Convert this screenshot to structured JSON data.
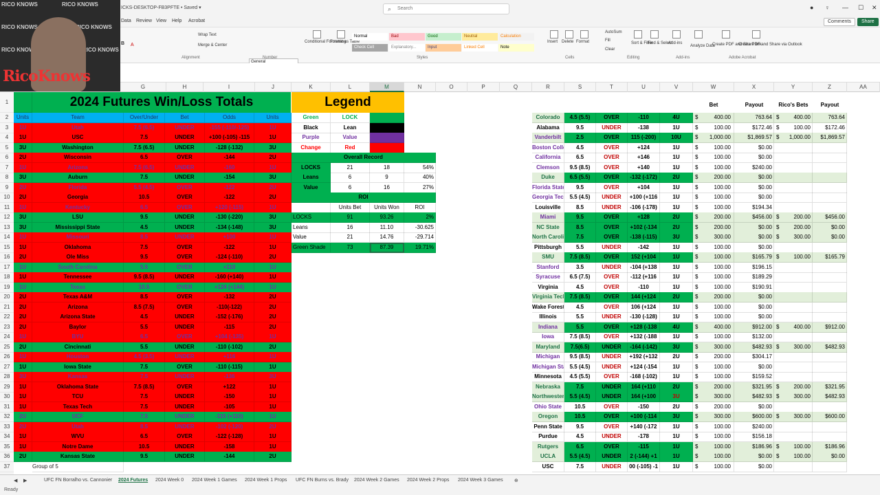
{
  "titlebar": {
    "file_name": "ICKS-DESKTOP-FB3PFTE • Saved ▾",
    "search_placeholder": "Search"
  },
  "tabs": [
    "Data",
    "Review",
    "View",
    "Help",
    "Acrobat"
  ],
  "top_buttons": {
    "comments": "Comments",
    "share": "Share"
  },
  "ribbon": {
    "labels": [
      "Wrap Text",
      "Merge & Center",
      "General",
      "Conditional Formatting",
      "Format as Table",
      "Insert",
      "Delete",
      "Format",
      "AutoSum",
      "Fill",
      "Clear",
      "Sort & Filter",
      "Find & Select",
      "Add-ins",
      "Analyze Data",
      "Create PDF and Share link",
      "Create PDF and Share via Outlook"
    ],
    "groups": [
      "Alignment",
      "Number",
      "Styles",
      "Cells",
      "Editing",
      "Add-ins",
      "Adobe Acrobat"
    ],
    "styles": [
      "Normal",
      "Bad",
      "Good",
      "Neutral",
      "Calculation",
      "Check Cell",
      "Explanatory...",
      "Input",
      "Linked Cell",
      "Note"
    ]
  },
  "columns": [
    "G",
    "H",
    "I",
    "J",
    "K",
    "L",
    "M",
    "N",
    "O",
    "P",
    "Q",
    "R",
    "S",
    "T",
    "U",
    "V",
    "W",
    "X",
    "Y",
    "Z",
    "AA"
  ],
  "selected_column": "M",
  "row_numbers": [
    "1",
    "2",
    "3",
    "4",
    "5",
    "6",
    "7",
    "8",
    "9",
    "10",
    "11",
    "12",
    "13",
    "14",
    "15",
    "16",
    "17",
    "18",
    "19",
    "20",
    "21",
    "22",
    "23",
    "24",
    "25",
    "26",
    "27",
    "28",
    "29",
    "30",
    "31",
    "32",
    "33",
    "34",
    "35",
    "36",
    "37"
  ],
  "futures": {
    "title": "2024 Futures Win/Loss Totals",
    "headers": [
      "Units",
      "Team",
      "Over/Under",
      "Bet",
      "Odds",
      "Units"
    ],
    "rows": [
      {
        "c": "red",
        "u": "1U",
        "t": "Utah",
        "ou": "7.5 (6.5)",
        "b": "UNDER",
        "o": "-155 (-110/-125)",
        "u2": "1U",
        "p": true
      },
      {
        "c": "red",
        "u": "1U",
        "t": "USC",
        "ou": "7.5",
        "b": "UNDER",
        "o": "+100 (-105) -115",
        "u2": "1U"
      },
      {
        "c": "grn",
        "u": "3U",
        "t": "Washington",
        "ou": "7.5 (6.5)",
        "b": "UNDER",
        "o": "-128 (-132)",
        "u2": "3U"
      },
      {
        "c": "red",
        "u": "2U",
        "t": "Wisconsin",
        "ou": "6.5",
        "b": "OVER",
        "o": "-144",
        "u2": "2U"
      },
      {
        "c": "red",
        "u": "1U",
        "t": "Arizona",
        "ou": "7.5 (6.5)",
        "b": "UNDER",
        "o": "-160",
        "u2": "1U",
        "p": true
      },
      {
        "c": "grn",
        "u": "3U",
        "t": "Auburn",
        "ou": "7.5",
        "b": "UNDER",
        "o": "-154",
        "u2": "3U"
      },
      {
        "c": "red",
        "u": "2U",
        "t": "Florida",
        "ou": "5.5 (4.5)",
        "b": "OVER",
        "o": "-122",
        "u2": "2U",
        "p": true
      },
      {
        "c": "red",
        "u": "2U",
        "t": "Georgia",
        "ou": "10.5",
        "b": "OVER",
        "o": "-122",
        "u2": "2U"
      },
      {
        "c": "red",
        "u": "1U",
        "t": "Kentucky",
        "ou": "6.5",
        "b": "OVER",
        "o": "+120 (-115)",
        "u2": "1U",
        "p": true
      },
      {
        "c": "grn",
        "u": "3U",
        "t": "LSU",
        "ou": "9.5",
        "b": "UNDER",
        "o": "-130 (-220)",
        "u2": "3U"
      },
      {
        "c": "grn",
        "u": "3U",
        "t": "Mississippi State",
        "ou": "4.5",
        "b": "UNDER",
        "o": "-134 (-148)",
        "u2": "3U"
      },
      {
        "c": "red",
        "u": "1U",
        "t": "Missouri",
        "ou": "8.5",
        "b": "UNDER",
        "o": "+100",
        "u2": "1U",
        "p": true
      },
      {
        "c": "red",
        "u": "1U",
        "t": "Oklahoma",
        "ou": "7.5",
        "b": "OVER",
        "o": "-122",
        "u2": "1U"
      },
      {
        "c": "red",
        "u": "2U",
        "t": "Ole Miss",
        "ou": "9.5",
        "b": "OVER",
        "o": "-124 (-110)",
        "u2": "2U"
      },
      {
        "c": "grn",
        "u": "1U",
        "t": "South Carolina",
        "ou": "5.5",
        "b": "OVER",
        "o": "+110",
        "u2": "1U",
        "p": true
      },
      {
        "c": "red",
        "u": "1U",
        "t": "Tennessee",
        "ou": "9.5 (8.5)",
        "b": "UNDER",
        "o": "-160 (+140)",
        "u2": "1U"
      },
      {
        "c": "grn",
        "u": "1U",
        "t": "Texas",
        "ou": "10.5",
        "b": "OVER",
        "o": "+124 (+144)",
        "u2": "1U",
        "p": true
      },
      {
        "c": "red",
        "u": "2U",
        "t": "Texas A&M",
        "ou": "8.5",
        "b": "OVER",
        "o": "-132",
        "u2": "2U"
      },
      {
        "c": "red",
        "u": "2U",
        "t": "Arizona",
        "ou": "8.5 (7.5)",
        "b": "OVER",
        "o": "-110(-122)",
        "u2": "2U"
      },
      {
        "c": "red",
        "u": "2U",
        "t": "Arizona State",
        "ou": "4.5",
        "b": "UNDER",
        "o": "-152 (-176)",
        "u2": "2U"
      },
      {
        "c": "red",
        "u": "2U",
        "t": "Baylor",
        "ou": "5.5",
        "b": "UNDER",
        "o": "-115",
        "u2": "2U"
      },
      {
        "c": "red",
        "u": "1U",
        "t": "BYU",
        "ou": "6.5",
        "b": "OVER",
        "o": "+104 (-135)",
        "u2": "1U",
        "p": true
      },
      {
        "c": "grn",
        "u": "2U",
        "t": "Cincinnati",
        "ou": "5.5",
        "b": "UNDER",
        "o": "-110 (-102)",
        "u2": "2U"
      },
      {
        "c": "red",
        "u": "1U",
        "t": "Houston",
        "ou": "4.5 (3.5)",
        "b": "UNDER",
        "o": "+116",
        "u2": "1U",
        "p": true
      },
      {
        "c": "grn",
        "u": "1U",
        "t": "Iowa State",
        "ou": "7.5",
        "b": "OVER",
        "o": "-110 (-115)",
        "u2": "1U"
      },
      {
        "c": "red",
        "u": "3U",
        "t": "Kansas",
        "ou": "7.5",
        "b": "UNDER",
        "o": "-136",
        "u2": "3U",
        "p": true
      },
      {
        "c": "red",
        "u": "1U",
        "t": "Oklahoma State",
        "ou": "7.5 (8.5)",
        "b": "OVER",
        "o": "+122",
        "u2": "1U"
      },
      {
        "c": "red",
        "u": "1U",
        "t": "TCU",
        "ou": "7.5",
        "b": "UNDER",
        "o": "-150",
        "u2": "1U"
      },
      {
        "c": "red",
        "u": "1U",
        "t": "Texas Tech",
        "ou": "7.5",
        "b": "UNDER",
        "o": "-105",
        "u2": "1U"
      },
      {
        "c": "grn",
        "u": "2U",
        "t": "UCF",
        "ou": "7.5",
        "b": "UNDER",
        "o": "-115 (+110)",
        "u2": "1U",
        "p": true
      },
      {
        "c": "red",
        "u": "2U",
        "t": "Utah",
        "ou": "8.5",
        "b": "UNDER",
        "o": "-102 (-120)",
        "u2": "2U",
        "p": true
      },
      {
        "c": "red",
        "u": "1U",
        "t": "WVU",
        "ou": "6.5",
        "b": "OVER",
        "o": "-122 (-128)",
        "u2": "1U"
      },
      {
        "c": "red",
        "u": "1U",
        "t": "Notre Dame",
        "ou": "10.5",
        "b": "UNDER",
        "o": "-158",
        "u2": "1U"
      },
      {
        "c": "grn",
        "u": "2U",
        "t": "Kansas State",
        "ou": "9.5",
        "b": "UNDER",
        "o": "-144",
        "u2": "2U"
      }
    ],
    "group_label": "Group of 5"
  },
  "legend": {
    "title": "Legend",
    "rows": [
      {
        "k": "Green",
        "v": "LOCK",
        "sw": "#00b050"
      },
      {
        "k": "Black",
        "v": "Lean",
        "sw": "#000000"
      },
      {
        "k": "Purple",
        "v": "Value",
        "sw": "#7030a0"
      },
      {
        "k": "Change",
        "v": "Red",
        "sw": "#ff0000"
      }
    ]
  },
  "overall": {
    "title": "Overall Record",
    "rows": [
      [
        "LOCKS",
        "21",
        "18",
        "54%"
      ],
      [
        "Leans",
        "6",
        "9",
        "40%"
      ],
      [
        "Value",
        "6",
        "16",
        "27%"
      ]
    ]
  },
  "roi": {
    "title": "ROI",
    "headers": [
      "Units Bet",
      "Units Won",
      "ROI"
    ],
    "rows": [
      [
        "LOCKS",
        "91",
        "93.26",
        "2%"
      ],
      [
        "Leans",
        "16",
        "11.10",
        "-30.625"
      ],
      [
        "Value",
        "21",
        "14.76",
        "-29.714"
      ],
      [
        "Green Shade",
        "73",
        "87.39",
        "19.71%"
      ]
    ]
  },
  "right_headers": {
    "bet": "Bet",
    "payout": "Payout",
    "rico": "Rico's Bets",
    "payout2": "Payout"
  },
  "bets": [
    {
      "t": "Colorado",
      "ou": "4.5 (5.5)",
      "b": "OVER",
      "o": "-110",
      "u": "4U",
      "bet": "400.00",
      "pay": "763.64",
      "r": "400.00",
      "rp": "763.64",
      "col": "g"
    },
    {
      "t": "Alabama",
      "ou": "9.5",
      "b": "UNDER",
      "o": "-138",
      "u": "1U",
      "bet": "100.00",
      "pay": "$172.46",
      "r": "100.00",
      "rp": "$172.46",
      "col": "w"
    },
    {
      "t": "Vanderbilt",
      "ou": "2.5",
      "b": "OVER",
      "o": "115 (-200)",
      "u": "10U",
      "bet": "1,000.00",
      "pay": "$1,869.57",
      "r": "1,000.00",
      "rp": "$1,869.57",
      "col": "g",
      "p": true
    },
    {
      "t": "Boston College",
      "ou": "4.5",
      "b": "OVER",
      "o": "+124",
      "u": "1U",
      "bet": "100.00",
      "pay": "$0.00",
      "r": "",
      "rp": "",
      "col": "w",
      "p": true
    },
    {
      "t": "California",
      "ou": "6.5",
      "b": "OVER",
      "o": "+146",
      "u": "1U",
      "bet": "100.00",
      "pay": "$0.00",
      "r": "",
      "rp": "",
      "col": "w",
      "p": true
    },
    {
      "t": "Clemson",
      "ou": "9.5 (8.5)",
      "b": "OVER",
      "o": "+140",
      "u": "1U",
      "bet": "100.00",
      "pay": "$240.00",
      "r": "",
      "rp": "",
      "col": "w",
      "p": true
    },
    {
      "t": "Duke",
      "ou": "6.5 (5.5)",
      "b": "OVER",
      "o": "-132 (-172)",
      "u": "2U",
      "bet": "200.00",
      "pay": "$0.00",
      "r": "",
      "rp": "",
      "col": "g"
    },
    {
      "t": "Florida State",
      "ou": "9.5",
      "b": "OVER",
      "o": "+104",
      "u": "1U",
      "bet": "100.00",
      "pay": "$0.00",
      "r": "",
      "rp": "",
      "col": "w",
      "p": true
    },
    {
      "t": "Georgia Tech",
      "ou": "5.5 (4.5)",
      "b": "UNDER",
      "o": "+100 (+116",
      "u": "1U",
      "bet": "100.00",
      "pay": "$0.00",
      "r": "",
      "rp": "",
      "col": "w",
      "p": true
    },
    {
      "t": "Louisville",
      "ou": "8.5",
      "b": "UNDER",
      "o": "-106 (-178)",
      "u": "1U",
      "bet": "100.00",
      "pay": "$194.34",
      "r": "",
      "rp": "",
      "col": "w"
    },
    {
      "t": "Miami",
      "ou": "9.5",
      "b": "OVER",
      "o": "+128",
      "u": "2U",
      "bet": "200.00",
      "pay": "$456.00",
      "r": "200.00",
      "rp": "$456.00",
      "col": "g",
      "p": true
    },
    {
      "t": "NC State",
      "ou": "8.5",
      "b": "OVER",
      "o": "+102 (-134",
      "u": "2U",
      "bet": "200.00",
      "pay": "$0.00",
      "r": "200.00",
      "rp": "$0.00",
      "col": "g"
    },
    {
      "t": "North Carolina",
      "ou": "7.5",
      "b": "OVER",
      "o": "-138 (-115)",
      "u": "3U",
      "bet": "300.00",
      "pay": "$0.00",
      "r": "300.00",
      "rp": "$0.00",
      "col": "g"
    },
    {
      "t": "Pittsburgh",
      "ou": "5.5",
      "b": "UNDER",
      "o": "-142",
      "u": "1U",
      "bet": "100.00",
      "pay": "$0.00",
      "r": "",
      "rp": "",
      "col": "w"
    },
    {
      "t": "SMU",
      "ou": "7.5 (8.5)",
      "b": "OVER",
      "o": "152 (+104",
      "u": "1U",
      "bet": "100.00",
      "pay": "$165.79",
      "r": "100.00",
      "rp": "$165.79",
      "col": "g"
    },
    {
      "t": "Stanford",
      "ou": "3.5",
      "b": "UNDER",
      "o": "-104 (+138",
      "u": "1U",
      "bet": "100.00",
      "pay": "$196.15",
      "r": "",
      "rp": "",
      "col": "w",
      "p": true
    },
    {
      "t": "Syracuse",
      "ou": "6.5 (7.5)",
      "b": "OVER",
      "o": "-112 (+116",
      "u": "1U",
      "bet": "100.00",
      "pay": "$189.29",
      "r": "",
      "rp": "",
      "col": "w",
      "p": true
    },
    {
      "t": "Virginia",
      "ou": "4.5",
      "b": "OVER",
      "o": "-110",
      "u": "1U",
      "bet": "100.00",
      "pay": "$190.91",
      "r": "",
      "rp": "",
      "col": "w"
    },
    {
      "t": "Virginia Tech",
      "ou": "7.5 (8.5)",
      "b": "OVER",
      "o": "144 (+124",
      "u": "2U",
      "bet": "200.00",
      "pay": "$0.00",
      "r": "",
      "rp": "",
      "col": "g"
    },
    {
      "t": "Wake Forest",
      "ou": "4.5",
      "b": "OVER",
      "o": "106 (+124",
      "u": "1U",
      "bet": "100.00",
      "pay": "$0.00",
      "r": "",
      "rp": "",
      "col": "w"
    },
    {
      "t": "Illinois",
      "ou": "5.5",
      "b": "UNDER",
      "o": "-130 (-128)",
      "u": "1U",
      "bet": "100.00",
      "pay": "$0.00",
      "r": "",
      "rp": "",
      "col": "w"
    },
    {
      "t": "Indiana",
      "ou": "5.5",
      "b": "OVER",
      "o": "+128 (-138",
      "u": "4U",
      "bet": "400.00",
      "pay": "$912.00",
      "r": "400.00",
      "rp": "$912.00",
      "col": "g",
      "p": true
    },
    {
      "t": "Iowa",
      "ou": "7.5 (8.5)",
      "b": "OVER",
      "o": "+132 (-188",
      "u": "1U",
      "bet": "100.00",
      "pay": "$132.00",
      "r": "",
      "rp": "",
      "col": "w",
      "p": true
    },
    {
      "t": "Maryland",
      "ou": "7.5(6.5)",
      "b": "UNDER",
      "o": "-164 (-142)",
      "u": "3U",
      "bet": "300.00",
      "pay": "$482.93",
      "r": "300.00",
      "rp": "$482.93",
      "col": "g"
    },
    {
      "t": "Michigan",
      "ou": "9.5 (8.5)",
      "b": "UNDER",
      "o": "+192 (+132",
      "u": "2U",
      "bet": "200.00",
      "pay": "$304.17",
      "r": "",
      "rp": "",
      "col": "w",
      "p": true
    },
    {
      "t": "Michigan State",
      "ou": "5.5 (4.5)",
      "b": "UNDER",
      "o": "+124 (-154",
      "u": "1U",
      "bet": "100.00",
      "pay": "$0.00",
      "r": "",
      "rp": "",
      "col": "w",
      "p": true
    },
    {
      "t": "Minnesota",
      "ou": "4.5 (5.5)",
      "b": "OVER",
      "o": "-168 (-102)",
      "u": "1U",
      "bet": "100.00",
      "pay": "$159.52",
      "r": "",
      "rp": "",
      "col": "w"
    },
    {
      "t": "Nebraska",
      "ou": "7.5",
      "b": "UNDER",
      "o": "164 (+110",
      "u": "2U",
      "bet": "200.00",
      "pay": "$321.95",
      "r": "200.00",
      "rp": "$321.95",
      "col": "g"
    },
    {
      "t": "Northwestern",
      "ou": "5.5 (4.5)",
      "b": "UNDER",
      "o": "164 (+100",
      "u": "3U",
      "bet": "300.00",
      "pay": "$482.93",
      "r": "300.00",
      "rp": "$482.93",
      "col": "g",
      "redu": true
    },
    {
      "t": "Ohio State",
      "ou": "10.5",
      "b": "OVER",
      "o": "-150",
      "u": "2U",
      "bet": "200.00",
      "pay": "$0.00",
      "r": "",
      "rp": "",
      "col": "w",
      "p": true
    },
    {
      "t": "Oregon",
      "ou": "10.5",
      "b": "OVER",
      "o": "+100 (-114",
      "u": "3U",
      "bet": "300.00",
      "pay": "$600.00",
      "r": "300.00",
      "rp": "$600.00",
      "col": "g"
    },
    {
      "t": "Penn State",
      "ou": "9.5",
      "b": "OVER",
      "o": "+140 (-172",
      "u": "1U",
      "bet": "100.00",
      "pay": "$240.00",
      "r": "",
      "rp": "",
      "col": "w"
    },
    {
      "t": "Purdue",
      "ou": "4.5",
      "b": "UNDER",
      "o": "-178",
      "u": "1U",
      "bet": "100.00",
      "pay": "$156.18",
      "r": "",
      "rp": "",
      "col": "w"
    },
    {
      "t": "Rutgers",
      "ou": "6.5",
      "b": "OVER",
      "o": "-115",
      "u": "1U",
      "bet": "100.00",
      "pay": "$186.96",
      "r": "100.00",
      "rp": "$186.96",
      "col": "g"
    },
    {
      "t": "UCLA",
      "ou": "5.5 (4.5)",
      "b": "UNDER",
      "o": "2 (-144) +1",
      "u": "1U",
      "bet": "100.00",
      "pay": "$0.00",
      "r": "100.00",
      "rp": "$0.00",
      "col": "g"
    },
    {
      "t": "USC",
      "ou": "7.5",
      "b": "UNDER",
      "o": "00 (-105) -1",
      "u": "1U",
      "bet": "100.00",
      "pay": "$0.00",
      "r": "",
      "rp": "",
      "col": "w"
    }
  ],
  "sheet_tabs": [
    "UFC FN Borralho vs. Cannonier",
    "2024 Futures",
    "2024 Week 0",
    "2024 Week 1 Games",
    "2024 Week 1 Props",
    "UFC FN Burns vs. Brady",
    "2024 Week 2 Games",
    "2024 Week 2 Props",
    "2024 Week 3 Games"
  ],
  "active_sheet": "2024 Futures",
  "status": "Ready",
  "webcam_brand": "RicoKnows",
  "webcam_bg_text": "RICO KNOWS"
}
